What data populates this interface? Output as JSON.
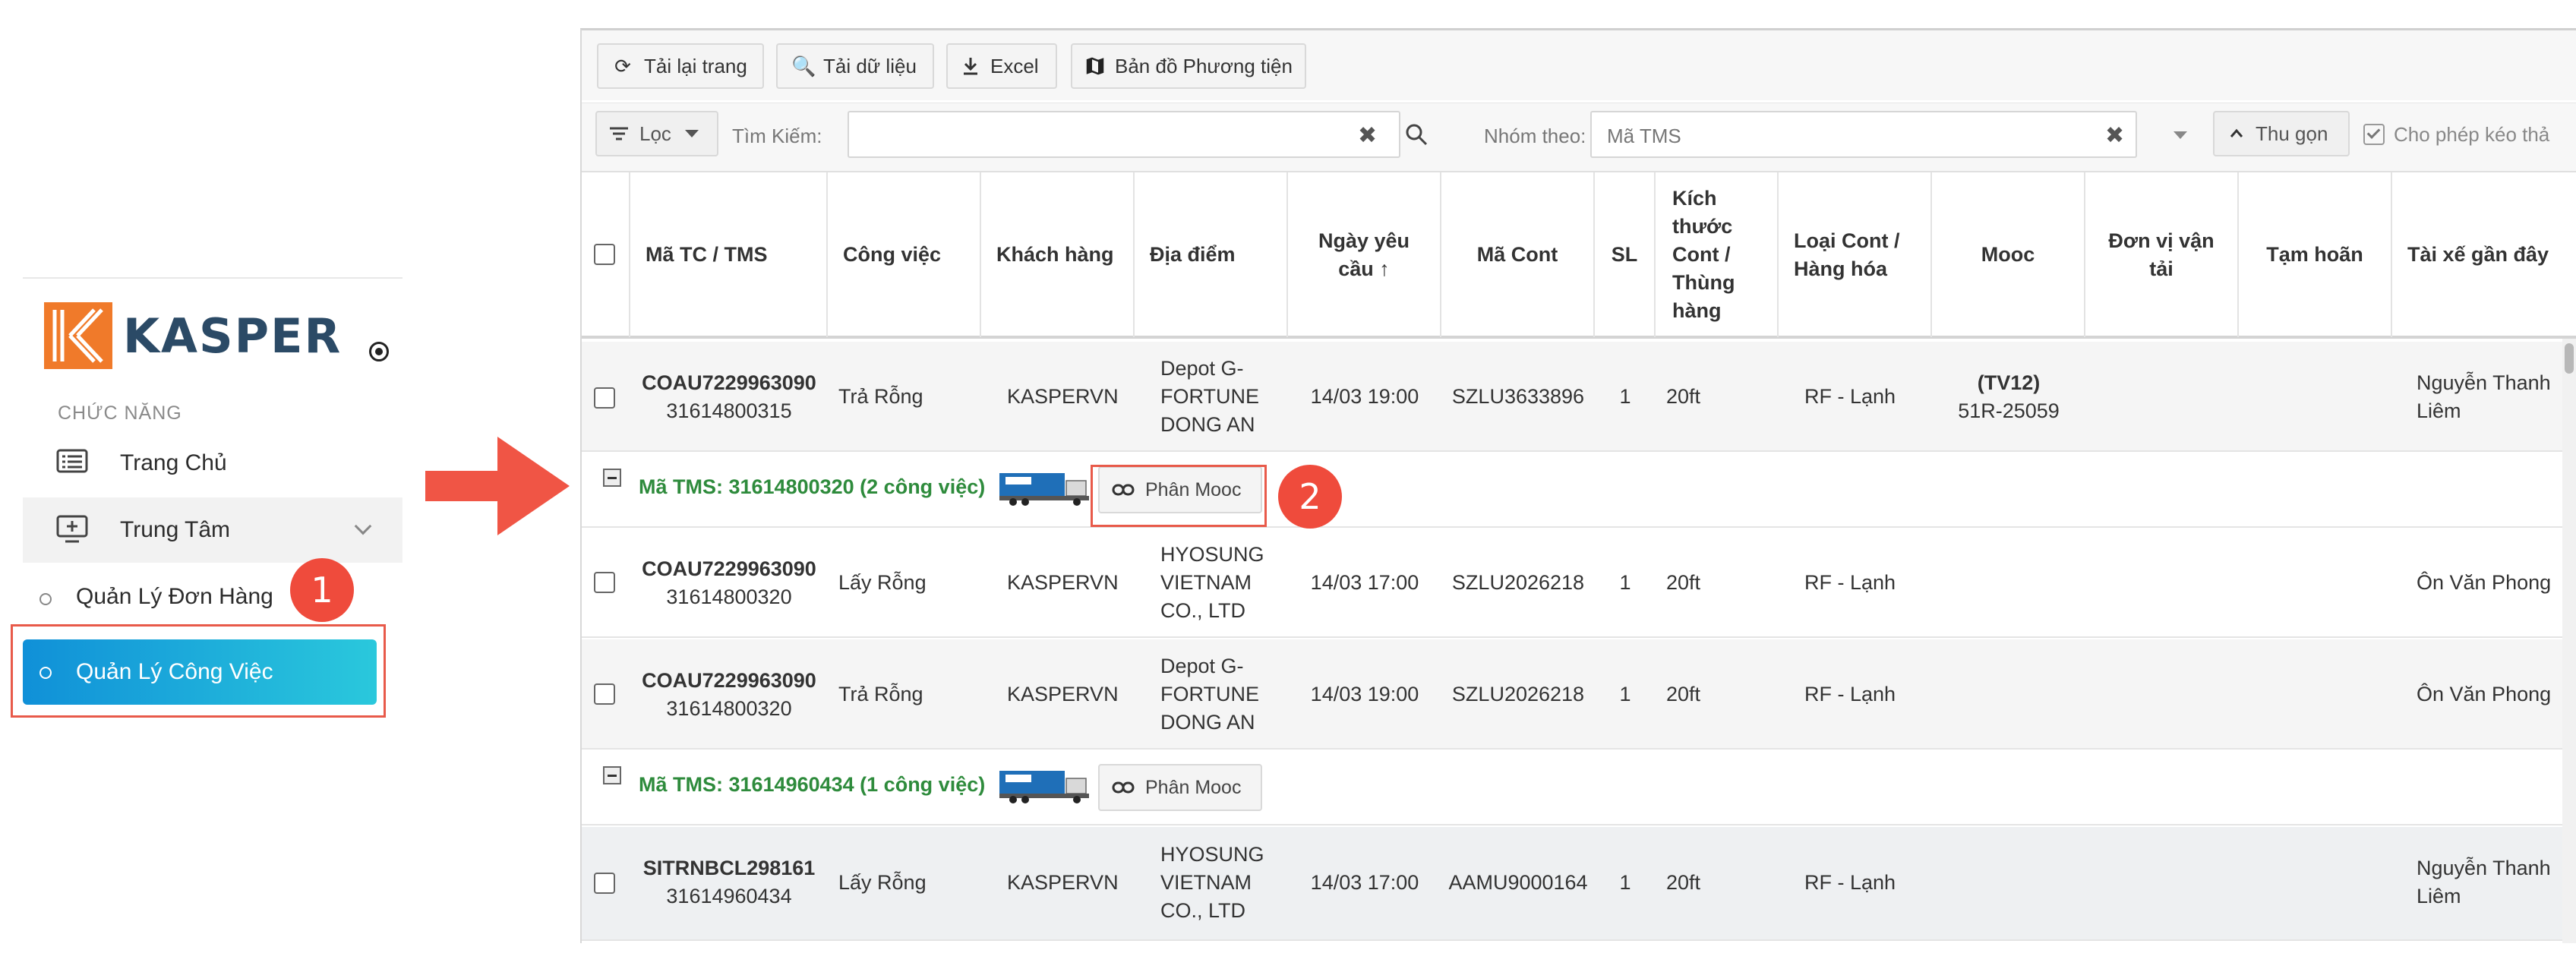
{
  "sidebar": {
    "brand": "KASPER",
    "section_label": "CHỨC NĂNG",
    "items": [
      {
        "label": "Trang Chủ"
      },
      {
        "label": "Trung Tâm"
      }
    ],
    "sub_items": [
      {
        "label": "Quản Lý Đơn Hàng"
      },
      {
        "label": "Quản Lý Công Việc",
        "active": true
      }
    ]
  },
  "callouts": {
    "one": "1",
    "two": "2"
  },
  "toolbar": {
    "reload": "Tải lại trang",
    "load_data": "Tải dữ liệu",
    "excel": "Excel",
    "vehicle_map": "Bản đồ Phương tiện"
  },
  "filters": {
    "filter_label": "Lọc",
    "search_label": "Tìm Kiếm:",
    "search_value": "",
    "group_label": "Nhóm theo:",
    "group_value": "Mã TMS",
    "collapse_label": "Thu gọn",
    "allow_drag_label": "Cho phép kéo thả"
  },
  "table": {
    "columns": [
      "Mã TC / TMS",
      "Công việc",
      "Khách hàng",
      "Địa điểm",
      "Ngày yêu cầu ↑",
      "Mã Cont",
      "SL",
      "Kích thước Cont / Thùng hàng",
      "Loại Cont / Hàng hóa",
      "Mooc",
      "Đơn vị vận tải",
      "Tạm hoãn",
      "Tài xế gần đây"
    ],
    "rows": [
      {
        "code": "COAU7229963090",
        "tms": "31614800315",
        "job": "Trả Rỗng",
        "customer": "KASPERVN",
        "location": "Depot G-FORTUNE DONG AN",
        "date": "14/03 19:00",
        "cont": "SZLU3633896",
        "qty": "1",
        "size": "20ft",
        "type": "RF - Lạnh",
        "mooc_code": "(TV12)",
        "mooc_plate": "51R-25059",
        "carrier": "",
        "hold": "",
        "driver": "Nguyễn Thanh Liêm"
      },
      {
        "code": "COAU7229963090",
        "tms": "31614800320",
        "job": "Lấy Rỗng",
        "customer": "KASPERVN",
        "location": "HYOSUNG VIETNAM CO., LTD",
        "date": "14/03 17:00",
        "cont": "SZLU2026218",
        "qty": "1",
        "size": "20ft",
        "type": "RF - Lạnh",
        "mooc_code": "",
        "mooc_plate": "",
        "carrier": "",
        "hold": "",
        "driver": "Ôn Văn Phong"
      },
      {
        "code": "COAU7229963090",
        "tms": "31614800320",
        "job": "Trả Rỗng",
        "customer": "KASPERVN",
        "location": "Depot G-FORTUNE DONG AN",
        "date": "14/03 19:00",
        "cont": "SZLU2026218",
        "qty": "1",
        "size": "20ft",
        "type": "RF - Lạnh",
        "mooc_code": "",
        "mooc_plate": "",
        "carrier": "",
        "hold": "",
        "driver": "Ôn Văn Phong"
      },
      {
        "code": "SITRNBCL298161",
        "tms": "31614960434",
        "job": "Lấy Rỗng",
        "customer": "KASPERVN",
        "location": "HYOSUNG VIETNAM CO., LTD",
        "date": "14/03 17:00",
        "cont": "AAMU9000164",
        "qty": "1",
        "size": "20ft",
        "type": "RF - Lạnh",
        "mooc_code": "",
        "mooc_plate": "",
        "carrier": "",
        "hold": "",
        "driver": "Nguyễn Thanh Liêm"
      }
    ],
    "groups": [
      {
        "label": "Mã TMS: 31614800320 (2 công việc)",
        "button": "Phân Mooc"
      },
      {
        "label": "Mã TMS: 31614960434 (1 công việc)",
        "button": "Phân Mooc"
      }
    ]
  },
  "colors": {
    "accent": "#1aa6dc",
    "group_text": "#2e8b3c",
    "highlight": "#e85a4a",
    "brand_orange": "#f07a2a",
    "brand_text": "#2b4a66"
  }
}
